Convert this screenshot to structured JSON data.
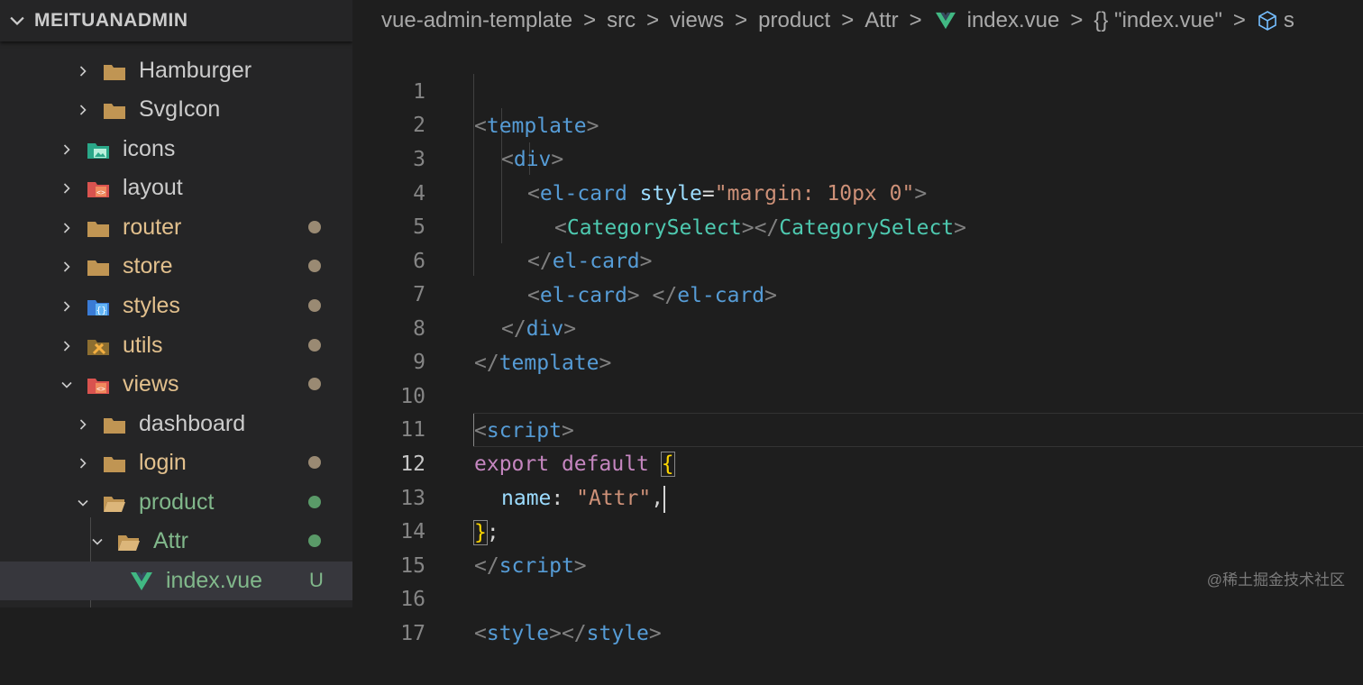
{
  "explorer": {
    "root_name": "MEITUANADMIN",
    "items": [
      {
        "label": "Hamburger",
        "icon": "folder-icon",
        "status": ""
      },
      {
        "label": "SvgIcon",
        "icon": "folder-icon",
        "status": ""
      },
      {
        "label": "icons",
        "icon": "images-folder-icon",
        "status": ""
      },
      {
        "label": "layout",
        "icon": "layout-folder-icon",
        "status": ""
      },
      {
        "label": "router",
        "icon": "folder-icon",
        "status": "modified"
      },
      {
        "label": "store",
        "icon": "folder-icon",
        "status": "modified"
      },
      {
        "label": "styles",
        "icon": "styles-folder-icon",
        "status": "modified"
      },
      {
        "label": "utils",
        "icon": "utils-folder-icon",
        "status": "modified"
      },
      {
        "label": "views",
        "icon": "views-folder-icon",
        "status": "modified"
      },
      {
        "label": "dashboard",
        "icon": "folder-icon",
        "status": ""
      },
      {
        "label": "login",
        "icon": "folder-icon",
        "status": "modified"
      },
      {
        "label": "product",
        "icon": "folder-open-icon",
        "status": "added"
      },
      {
        "label": "Attr",
        "icon": "folder-open-icon",
        "status": "added"
      },
      {
        "label": "index.vue",
        "icon": "vue-file-icon",
        "status": "untracked",
        "badge": "U"
      }
    ]
  },
  "breadcrumb": {
    "parts": [
      "vue-admin-template",
      "src",
      "views",
      "product",
      "Attr",
      "index.vue",
      "{} \"index.vue\""
    ],
    "trailing": "s"
  },
  "editor": {
    "current_line": 12,
    "lines": [
      {
        "n": "1"
      },
      {
        "n": "2"
      },
      {
        "n": "3"
      },
      {
        "n": "4"
      },
      {
        "n": "5"
      },
      {
        "n": "6"
      },
      {
        "n": "7"
      },
      {
        "n": "8"
      },
      {
        "n": "9"
      },
      {
        "n": "10"
      },
      {
        "n": "11"
      },
      {
        "n": "12"
      },
      {
        "n": "13"
      },
      {
        "n": "14"
      },
      {
        "n": "15"
      },
      {
        "n": "16"
      },
      {
        "n": "17"
      }
    ],
    "tokens": {
      "l1": [
        "<",
        "template",
        ">"
      ],
      "l2": [
        "<",
        "div",
        ">"
      ],
      "l3": [
        "<",
        "el-card",
        " ",
        "style",
        "=",
        "\"margin: 10px 0\"",
        ">"
      ],
      "l4": [
        "<",
        "CategorySelect",
        "></",
        "CategorySelect",
        ">"
      ],
      "l5": [
        "</",
        "el-card",
        ">"
      ],
      "l6": [
        "<",
        "el-card",
        ">",
        " ",
        "</",
        "el-card",
        ">"
      ],
      "l7": [
        "</",
        "div",
        ">"
      ],
      "l8": [
        "</",
        "template",
        ">"
      ],
      "l10": [
        "<",
        "script",
        ">"
      ],
      "l11": [
        "export",
        " ",
        "default",
        " ",
        "{"
      ],
      "l12": [
        "name",
        ": ",
        "\"Attr\"",
        ","
      ],
      "l13": [
        "}",
        ";"
      ],
      "l14": [
        "</",
        "script",
        ">"
      ],
      "l16": [
        "<",
        "style",
        "></",
        "style",
        ">"
      ]
    }
  },
  "watermark": "@稀土掘金技术社区",
  "colors": {
    "tag": "#569cd6",
    "component": "#4ec9b0",
    "attribute": "#9cdcfe",
    "string": "#ce9178",
    "keyword": "#c586c0",
    "modified": "#e2c08d",
    "added": "#81b88b"
  }
}
